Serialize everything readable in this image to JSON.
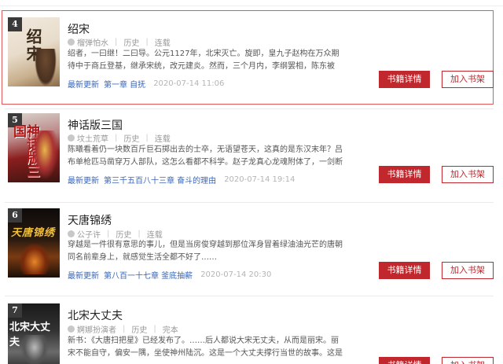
{
  "books": [
    {
      "rank": "4",
      "cover_text": "绍宋",
      "title": "绍宋",
      "author": "榴弹怕水",
      "category": "历史",
      "status": "连载",
      "desc": "绍者，一曰继！二曰导。公元1127年，北宋灭亡。旋即，皇九子赵构在万众期待中于商丘登基，继承宋统，改元建炎。然而，三个月内，李纲罢相，陈东被杀，岳飞被驱",
      "latest_label": "最新更新",
      "latest_chapter": "第一章 自抚",
      "date": "2020-07-14 11:06",
      "detail_btn": "书籍详情",
      "shelf_btn": "加入书架"
    },
    {
      "rank": "5",
      "cover_text": "神话版三国",
      "title": "神话版三国",
      "author": "坟土荒草",
      "category": "历史",
      "status": "连载",
      "desc": "陈曦看着仍一块数百斤巨石掷出去的士卒，无语望苍天，这真的是东汉末年？吕布单枪匹马凿穿万人部队，这怎么看都不科学。赵子龙真心龙魂附体了，一剑断山，这真",
      "latest_label": "最新更新",
      "latest_chapter": "第三千五百八十三章 奋斗的理由",
      "date": "2020-07-14 19:14",
      "detail_btn": "书籍详情",
      "shelf_btn": "加入书架"
    },
    {
      "rank": "6",
      "cover_text": "天唐锦绣",
      "title": "天唐锦绣",
      "author": "公子许",
      "category": "历史",
      "status": "连载",
      "desc": "穿越是一件很有意思的事儿，但是当房俊穿越到那位浑身冒着绿油油光芒的唐朝同名前辈身上，就感觉生活全都不好了……",
      "latest_label": "最新更新",
      "latest_chapter": "第八百一十七章 釜底抽薪",
      "date": "2020-07-14 20:30",
      "detail_btn": "书籍详情",
      "shelf_btn": "加入书架"
    },
    {
      "rank": "7",
      "cover_text": "北宋大丈夫",
      "title": "北宋大丈夫",
      "author": "婀娜扮演者",
      "category": "历史",
      "status": "完本",
      "desc": "新书：《大唐扫把星》已经发布了。……后人都说大宋无丈夫，从而是丽宋。丽宋不能自守，偏安一隅，坐使神州陆沉。这是一个大丈夫撑行当世的故事。这是一个站大",
      "latest_label": "最新更新",
      "latest_chapter": "",
      "date": "",
      "detail_btn": "书籍详情",
      "shelf_btn": "加入书架"
    }
  ],
  "colors": {
    "accent": "#c0282d",
    "link": "#3a66b5",
    "highlight_border": "#e05a5a"
  }
}
